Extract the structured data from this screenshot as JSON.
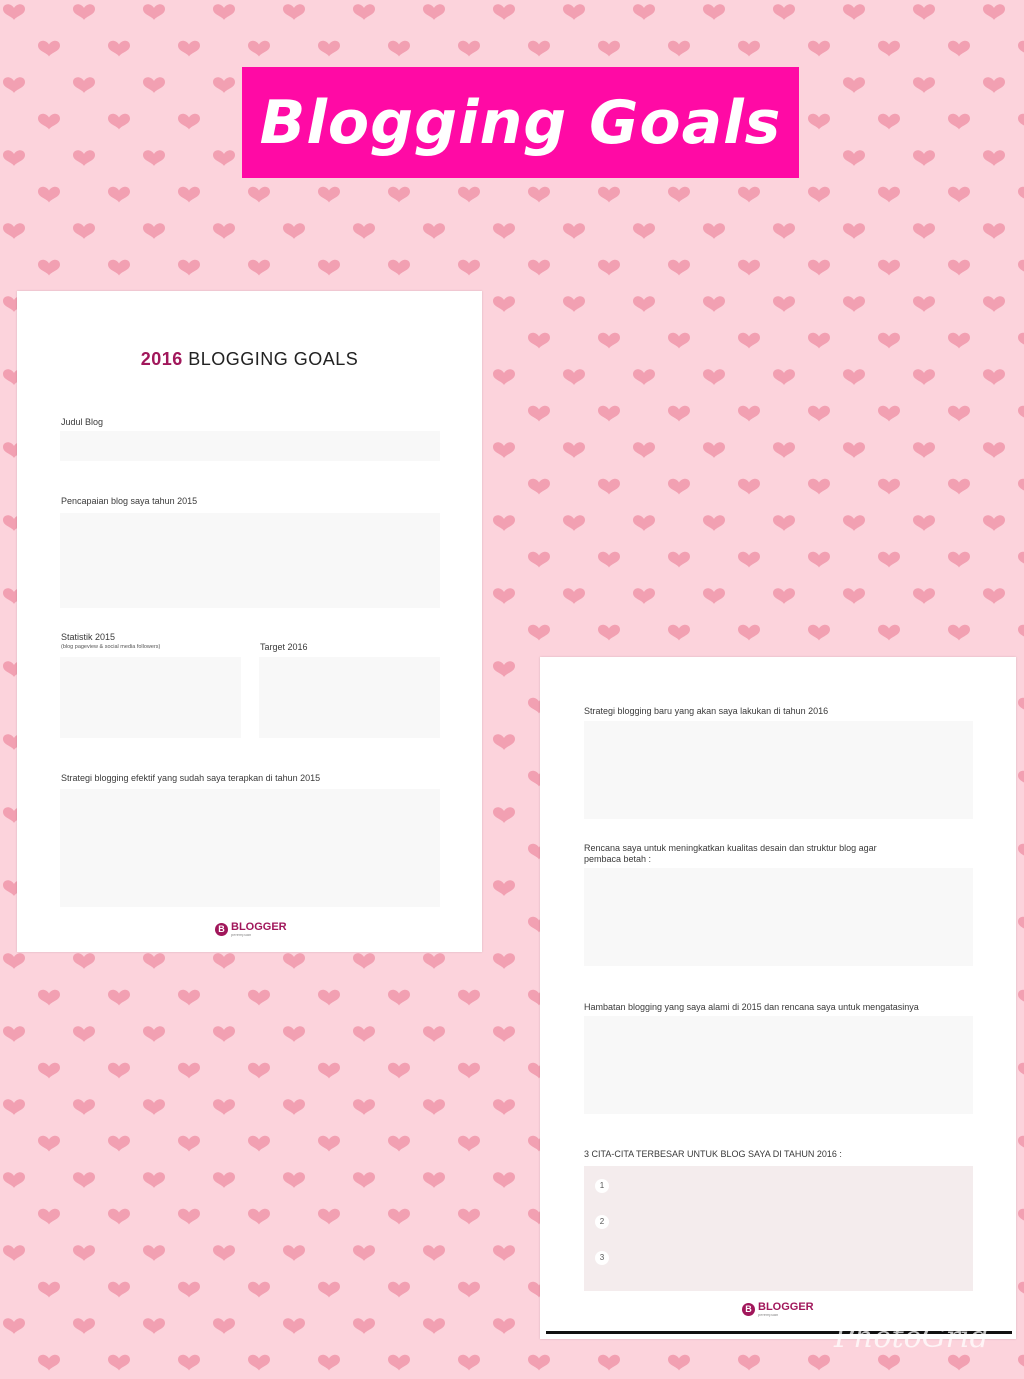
{
  "banner": {
    "title": "Blogging Goals"
  },
  "colors": {
    "background": "#fcd3dc",
    "hearts": "#f2a0b2",
    "banner": "#ff0aa5",
    "accent": "#a1175b",
    "field": "#f8f8f8"
  },
  "page1": {
    "title_year": "2016",
    "title_rest": " BLOGGING GOALS",
    "judul_label": "Judul Blog",
    "pencapaian_label": "Pencapaian blog saya tahun 2015",
    "statistik_label": "Statistik 2015",
    "statistik_sublabel": "(blog pageview & social media followers)",
    "target_label": "Target 2016",
    "strategi_label": "Strategi blogging efektif yang sudah saya terapkan di tahun 2015"
  },
  "page2": {
    "strategi_baru_label": "Strategi blogging baru yang akan saya lakukan di tahun 2016",
    "rencana_label_line1": "Rencana saya untuk meningkatkan kualitas desain dan struktur blog agar",
    "rencana_label_line2": "pembaca betah :",
    "hambatan_label": "Hambatan blogging yang saya alami di 2015 dan rencana saya untuk mengatasinya",
    "cita_label": "3 CITA-CITA TERBESAR UNTUK BLOG SAYA DI TAHUN 2016 :",
    "numbers": [
      "1",
      "2",
      "3"
    ]
  },
  "logo": {
    "letter": "B",
    "name": "BLOGGER",
    "tagline": "perempuan"
  },
  "watermark": "PhotoGrid"
}
